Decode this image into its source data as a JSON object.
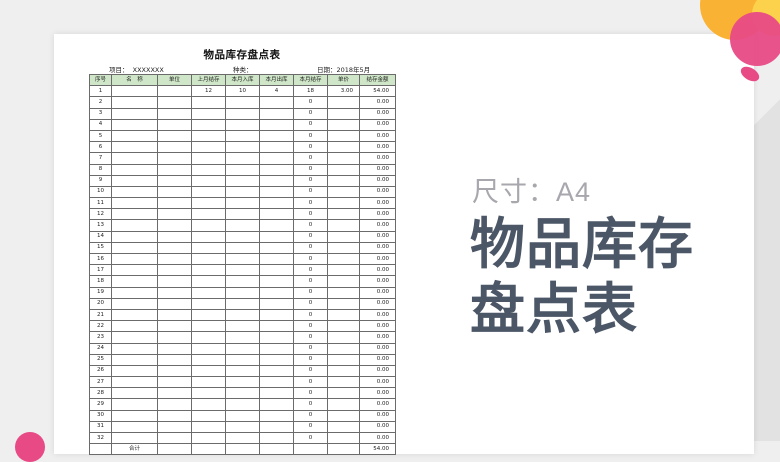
{
  "sheet": {
    "title": "物品库存盘点表",
    "project_label": "项目：",
    "project_value": "XXXXXXX",
    "category_label": "种类：",
    "date_label": "日期：",
    "date_value": "2018年5月",
    "headers": [
      "序号",
      "名　称",
      "单位",
      "上月结存",
      "本月入库",
      "本月出库",
      "本月结存",
      "单价",
      "结存金额"
    ],
    "rows": [
      [
        "1",
        "",
        "",
        "12",
        "10",
        "4",
        "18",
        "3.00",
        "54.00"
      ],
      [
        "2",
        "",
        "",
        "",
        "",
        "",
        "0",
        "",
        "0.00"
      ],
      [
        "3",
        "",
        "",
        "",
        "",
        "",
        "0",
        "",
        "0.00"
      ],
      [
        "4",
        "",
        "",
        "",
        "",
        "",
        "0",
        "",
        "0.00"
      ],
      [
        "5",
        "",
        "",
        "",
        "",
        "",
        "0",
        "",
        "0.00"
      ],
      [
        "6",
        "",
        "",
        "",
        "",
        "",
        "0",
        "",
        "0.00"
      ],
      [
        "7",
        "",
        "",
        "",
        "",
        "",
        "0",
        "",
        "0.00"
      ],
      [
        "8",
        "",
        "",
        "",
        "",
        "",
        "0",
        "",
        "0.00"
      ],
      [
        "9",
        "",
        "",
        "",
        "",
        "",
        "0",
        "",
        "0.00"
      ],
      [
        "10",
        "",
        "",
        "",
        "",
        "",
        "0",
        "",
        "0.00"
      ],
      [
        "11",
        "",
        "",
        "",
        "",
        "",
        "0",
        "",
        "0.00"
      ],
      [
        "12",
        "",
        "",
        "",
        "",
        "",
        "0",
        "",
        "0.00"
      ],
      [
        "13",
        "",
        "",
        "",
        "",
        "",
        "0",
        "",
        "0.00"
      ],
      [
        "14",
        "",
        "",
        "",
        "",
        "",
        "0",
        "",
        "0.00"
      ],
      [
        "15",
        "",
        "",
        "",
        "",
        "",
        "0",
        "",
        "0.00"
      ],
      [
        "16",
        "",
        "",
        "",
        "",
        "",
        "0",
        "",
        "0.00"
      ],
      [
        "17",
        "",
        "",
        "",
        "",
        "",
        "0",
        "",
        "0.00"
      ],
      [
        "18",
        "",
        "",
        "",
        "",
        "",
        "0",
        "",
        "0.00"
      ],
      [
        "19",
        "",
        "",
        "",
        "",
        "",
        "0",
        "",
        "0.00"
      ],
      [
        "20",
        "",
        "",
        "",
        "",
        "",
        "0",
        "",
        "0.00"
      ],
      [
        "21",
        "",
        "",
        "",
        "",
        "",
        "0",
        "",
        "0.00"
      ],
      [
        "22",
        "",
        "",
        "",
        "",
        "",
        "0",
        "",
        "0.00"
      ],
      [
        "23",
        "",
        "",
        "",
        "",
        "",
        "0",
        "",
        "0.00"
      ],
      [
        "24",
        "",
        "",
        "",
        "",
        "",
        "0",
        "",
        "0.00"
      ],
      [
        "25",
        "",
        "",
        "",
        "",
        "",
        "0",
        "",
        "0.00"
      ],
      [
        "26",
        "",
        "",
        "",
        "",
        "",
        "0",
        "",
        "0.00"
      ],
      [
        "27",
        "",
        "",
        "",
        "",
        "",
        "0",
        "",
        "0.00"
      ],
      [
        "28",
        "",
        "",
        "",
        "",
        "",
        "0",
        "",
        "0.00"
      ],
      [
        "29",
        "",
        "",
        "",
        "",
        "",
        "0",
        "",
        "0.00"
      ],
      [
        "30",
        "",
        "",
        "",
        "",
        "",
        "0",
        "",
        "0.00"
      ],
      [
        "31",
        "",
        "",
        "",
        "",
        "",
        "0",
        "",
        "0.00"
      ],
      [
        "32",
        "",
        "",
        "",
        "",
        "",
        "0",
        "",
        "0.00"
      ],
      [
        "",
        "合计",
        "",
        "",
        "",
        "",
        "",
        "",
        "54.00"
      ]
    ]
  },
  "promo": {
    "size_label": "尺寸：A4",
    "title_line1": "物品库存",
    "title_line2": "盘点表"
  },
  "colors": {
    "header_fill": "#cfe7c8",
    "title_text": "#4b5667",
    "size_text": "#a7a7ad",
    "accent_pink": "#e84a86",
    "accent_orange": "#f9b233"
  }
}
